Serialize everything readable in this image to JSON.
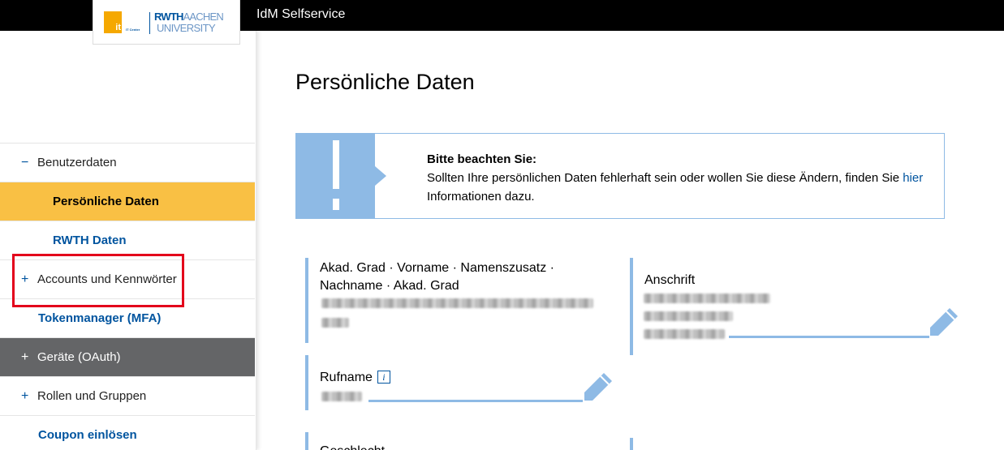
{
  "header": {
    "app_title": "IdM Selfservice",
    "logo": {
      "it_mark": "it",
      "it_center": "IT Center",
      "rwth": "RWTH",
      "aachen": "AACHEN",
      "university": "UNIVERSITY"
    }
  },
  "sidebar": {
    "items": [
      {
        "symbol": "−",
        "label": "Benutzerdaten"
      },
      {
        "label": "Persönliche Daten"
      },
      {
        "label": "RWTH Daten"
      },
      {
        "symbol": "+",
        "label": "Accounts und Kennwörter"
      },
      {
        "label": "Tokenmanager (MFA)"
      },
      {
        "symbol": "+",
        "label": "Geräte (OAuth)"
      },
      {
        "symbol": "+",
        "label": "Rollen und Gruppen"
      },
      {
        "label": "Coupon einlösen"
      }
    ]
  },
  "main": {
    "title": "Persönliche Daten",
    "notice": {
      "heading": "Bitte beachten Sie:",
      "text_before": "Sollten Ihre persönlichen Daten fehlerhaft sein oder wollen Sie diese Ändern, finden Sie ",
      "link": "hier",
      "text_after": " Informationen dazu."
    },
    "fields": {
      "name_label_line1": "Akad. Grad · Vorname · Namenszusatz ·",
      "name_label_line2": "Nachname · Akad. Grad",
      "address_label": "Anschrift",
      "rufname_label": "Rufname",
      "info_icon_glyph": "i",
      "next_label": "Geschlecht"
    }
  },
  "colors": {
    "brand_blue": "#00549f",
    "light_blue": "#8ebae5",
    "active_yellow": "#f9c044",
    "dark_gray": "#646567",
    "highlight_red": "#e3001b"
  }
}
